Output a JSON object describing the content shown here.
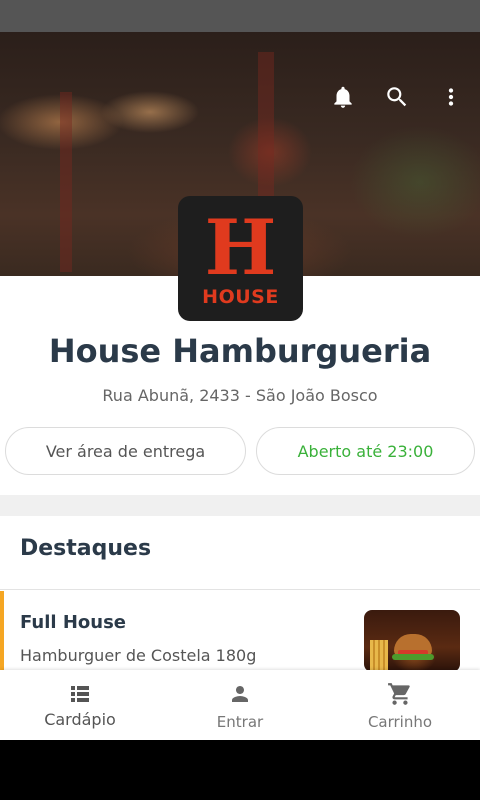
{
  "colors": {
    "title": "#2b3a49",
    "open_green": "#3ab13a",
    "logo_red": "#e03a1e",
    "accent_orange": "#f5a623"
  },
  "header": {
    "icons": [
      "bell-icon",
      "search-icon",
      "more-vert-icon"
    ]
  },
  "store": {
    "logo_letter": "H",
    "logo_word": "HOUSE",
    "name": "House Hamburgueria",
    "address": "Rua Abunã, 2433 - São João Bosco",
    "delivery_button": "Ver área de entrega",
    "status": "Aberto até 23:00"
  },
  "highlights": {
    "title": "Destaques",
    "items": [
      {
        "name": "Full House",
        "description": "Hamburguer de Costela 180g"
      }
    ]
  },
  "bottom_nav": {
    "items": [
      {
        "label": "Cardápio",
        "icon": "list-icon",
        "active": true
      },
      {
        "label": "Entrar",
        "icon": "person-icon",
        "active": false
      },
      {
        "label": "Carrinho",
        "icon": "cart-icon",
        "active": false
      }
    ]
  }
}
